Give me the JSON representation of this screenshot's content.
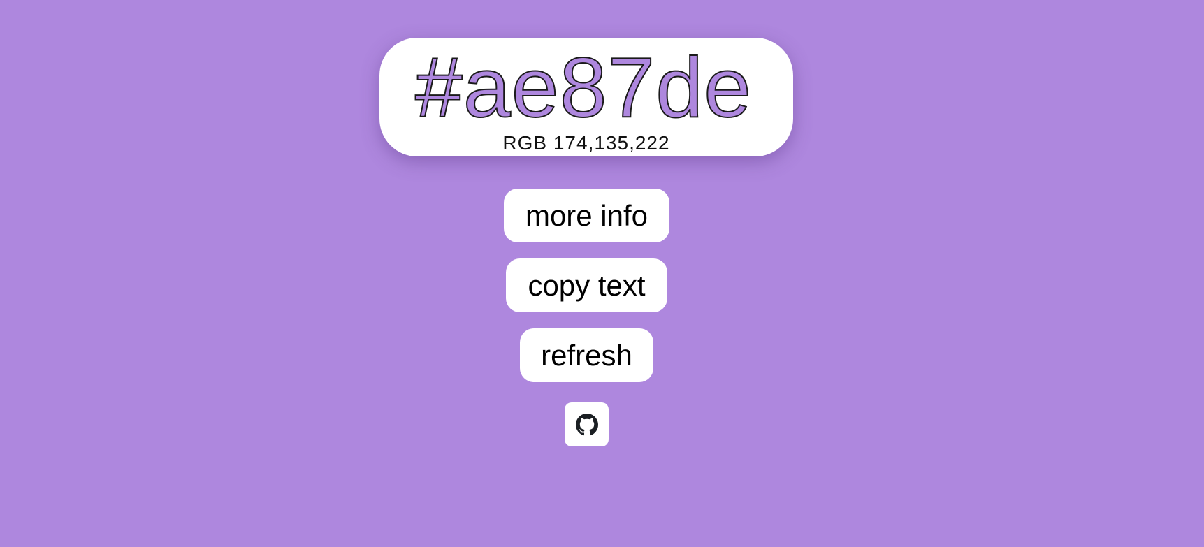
{
  "theme": {
    "background_color": "#ae87de",
    "card_color": "#ffffff",
    "text_color": "#000000"
  },
  "color_display": {
    "hex": "#ae87de",
    "rgb": "RGB 174,135,222"
  },
  "actions": {
    "more_info_label": "more info",
    "copy_text_label": "copy text",
    "refresh_label": "refresh",
    "github_icon": "github-icon"
  }
}
